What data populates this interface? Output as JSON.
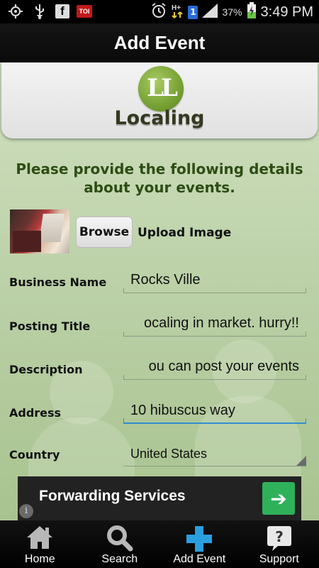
{
  "status_bar": {
    "battery": "37%",
    "time": "3:49 PM",
    "sim_label": "1",
    "toi_label": "TOI",
    "fb_label": "f"
  },
  "title": "Add Event",
  "logo": {
    "monogram": "LL",
    "name": "Localing"
  },
  "heading": "Please provide the following details about your events.",
  "image_upload": {
    "browse_label": "Browse",
    "upload_label": "Upload Image"
  },
  "form": {
    "business_name": {
      "label": "Business Name",
      "value": "Rocks Ville"
    },
    "posting_title": {
      "label": "Posting Title",
      "value": "ocaling in market. hurry!!"
    },
    "description": {
      "label": "Description",
      "value": "ou can post your events"
    },
    "address": {
      "label": "Address",
      "value": "10 hibuscus way"
    },
    "country": {
      "label": "Country",
      "value": "United States"
    }
  },
  "ad": {
    "text": "Forwarding Services",
    "arrow": "➔",
    "info": "i"
  },
  "nav": [
    {
      "label": "Home",
      "icon": "home-icon"
    },
    {
      "label": "Search",
      "icon": "search-icon"
    },
    {
      "label": "Add Event",
      "icon": "plus-icon"
    },
    {
      "label": "Support",
      "icon": "help-icon"
    }
  ],
  "colors": {
    "accent": "#2f8fce",
    "heading": "#2e4d14",
    "plus": "#2a9fe0"
  }
}
